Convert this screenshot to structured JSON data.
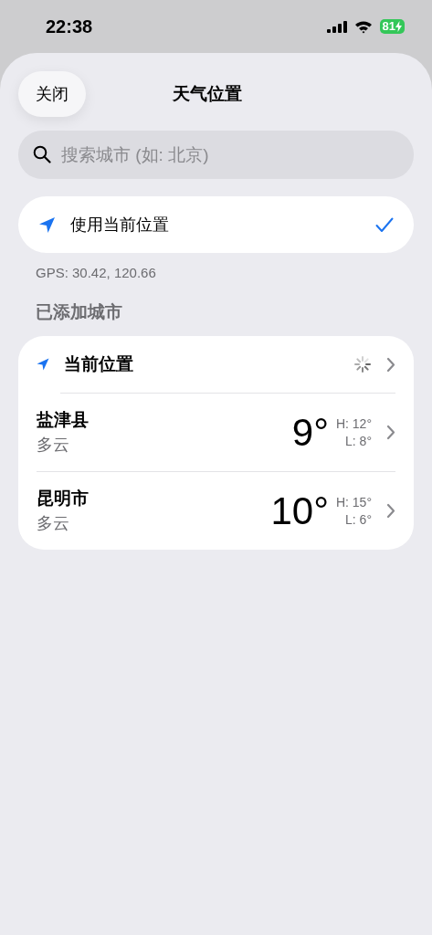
{
  "status_bar": {
    "time": "22:38",
    "battery": "81",
    "charging": true
  },
  "header": {
    "close": "关闭",
    "title": "天气位置"
  },
  "search": {
    "placeholder": "搜索城市 (如: 北京)"
  },
  "use_current": {
    "label": "使用当前位置",
    "checked": true
  },
  "gps": "GPS: 30.42, 120.66",
  "section_title": "已添加城市",
  "cities": [
    {
      "kind": "current",
      "name": "当前位置",
      "loading": true
    },
    {
      "kind": "city",
      "name": "盐津县",
      "condition": "多云",
      "temp": "9°",
      "high": "H: 12°",
      "low": "L: 8°"
    },
    {
      "kind": "city",
      "name": "昆明市",
      "condition": "多云",
      "temp": "10°",
      "high": "H: 15°",
      "low": "L: 6°"
    }
  ]
}
